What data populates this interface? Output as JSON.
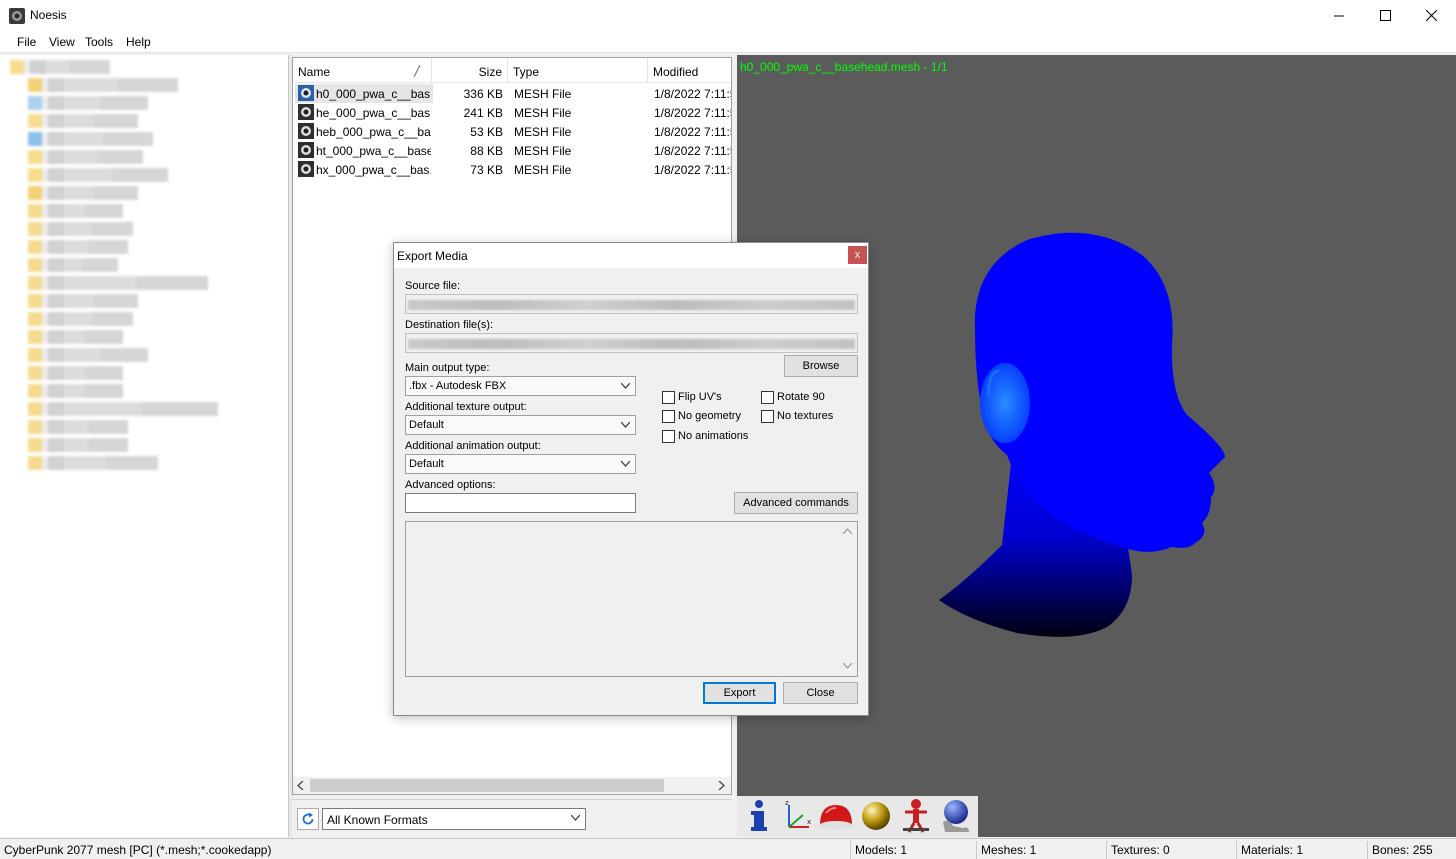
{
  "window": {
    "title": "Noesis"
  },
  "menu": [
    "File",
    "View",
    "Tools",
    "Help"
  ],
  "file_list": {
    "columns": [
      "Name",
      "Size",
      "Type",
      "Modified"
    ],
    "rows": [
      {
        "name": "h0_000_pwa_c__bas...",
        "size": "336 KB",
        "type": "MESH File",
        "modified": "1/8/2022 7:11:5"
      },
      {
        "name": "he_000_pwa_c__bas...",
        "size": "241 KB",
        "type": "MESH File",
        "modified": "1/8/2022 7:11:5"
      },
      {
        "name": "heb_000_pwa_c__ba...",
        "size": "53 KB",
        "type": "MESH File",
        "modified": "1/8/2022 7:11:5"
      },
      {
        "name": "ht_000_pwa_c__base...",
        "size": "88 KB",
        "type": "MESH File",
        "modified": "1/8/2022 7:11:5"
      },
      {
        "name": "hx_000_pwa_c__bas...",
        "size": "73 KB",
        "type": "MESH File",
        "modified": "1/8/2022 7:11:5"
      }
    ],
    "format_filter": "All Known Formats"
  },
  "viewport": {
    "label": "h0_000_pwa_c__basehead.mesh - 1/1",
    "label_color": "#00ff00",
    "model_color": "#0000ff"
  },
  "toolbar_icons": [
    "info-icon",
    "axes-icon",
    "dome-icon",
    "sphere-icon",
    "skeleton-icon",
    "globe-hand-icon"
  ],
  "status": {
    "format": "CyberPunk 2077 mesh [PC] (*.mesh;*.cookedapp)",
    "models": "Models: 1",
    "meshes": "Meshes: 1",
    "textures": "Textures: 0",
    "materials": "Materials: 1",
    "bones": "Bones: 255"
  },
  "dialog": {
    "title": "Export Media",
    "close_label": "x",
    "source_label": "Source file:",
    "dest_label": "Destination file(s):",
    "browse": "Browse",
    "main_output_label": "Main output type:",
    "main_output_value": ".fbx - Autodesk FBX",
    "texture_output_label": "Additional texture output:",
    "texture_output_value": "Default",
    "anim_output_label": "Additional animation output:",
    "anim_output_value": "Default",
    "advanced_options_label": "Advanced options:",
    "advanced_commands": "Advanced commands",
    "checkboxes": {
      "flip_uvs": "Flip UV's",
      "rotate_90": "Rotate 90",
      "no_geometry": "No geometry",
      "no_textures": "No textures",
      "no_animations": "No animations"
    },
    "export": "Export",
    "close": "Close"
  }
}
